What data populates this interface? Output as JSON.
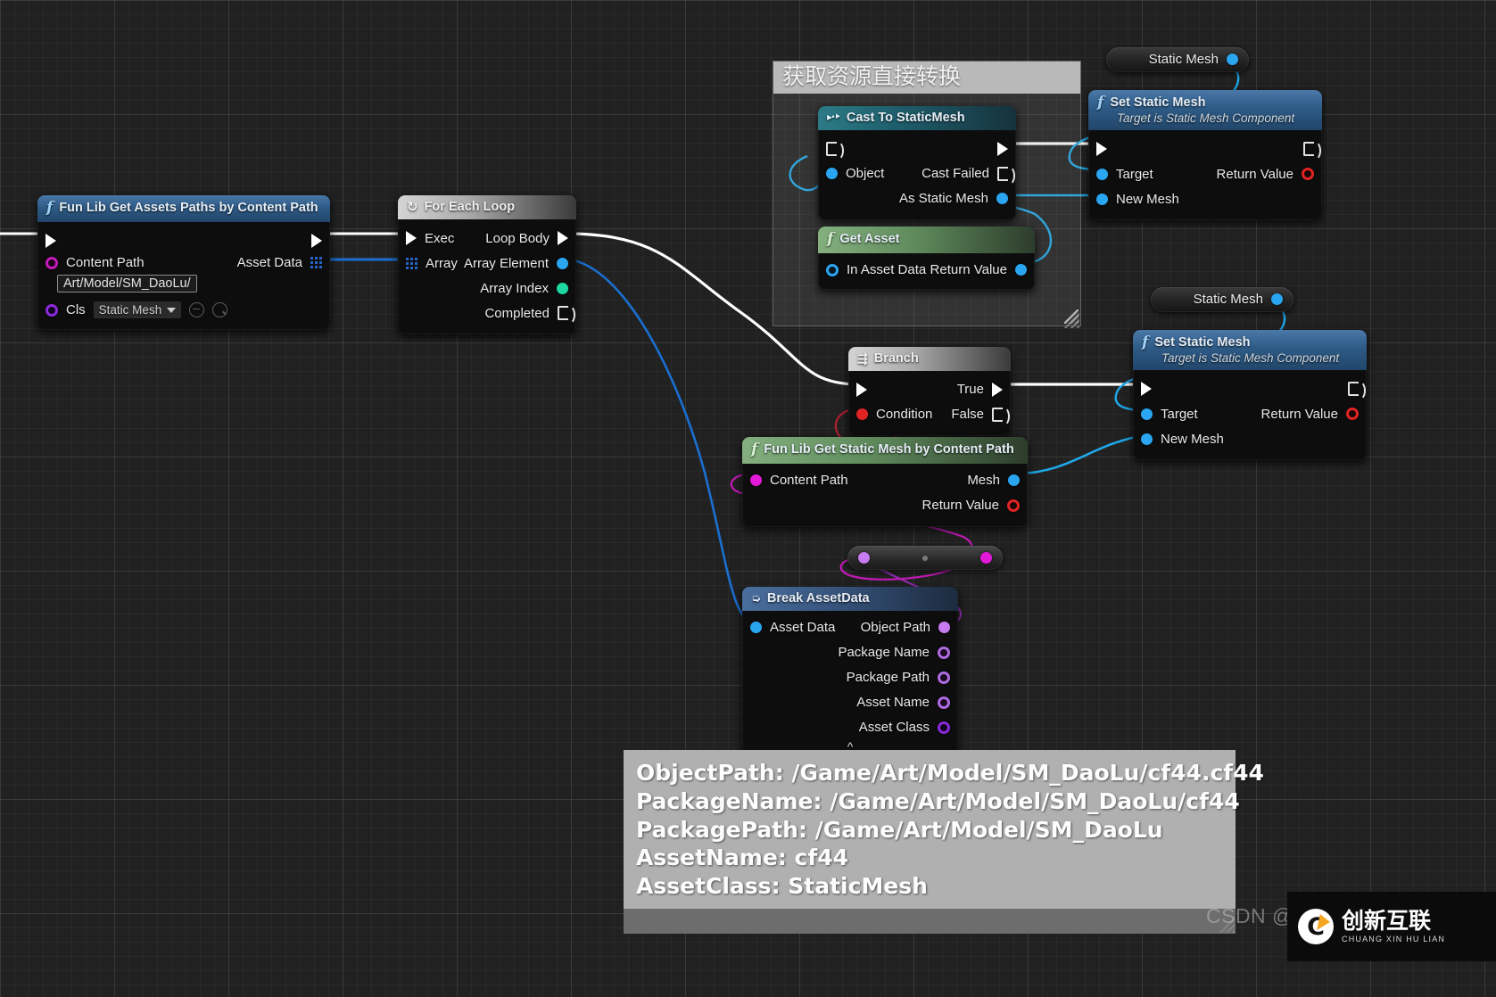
{
  "app": {
    "kind": "unreal-blueprint-graph"
  },
  "comment": {
    "title": "获取资源直接转换"
  },
  "nodes": {
    "fun_lib_get_assets_paths": {
      "title": "Fun Lib Get Assets Paths by Content Path",
      "icon": "function-f-icon",
      "inputs": {
        "exec": "",
        "content_path_label": "Content Path",
        "content_path_value": "Art/Model/SM_DaoLu/",
        "cls_label": "Cls",
        "cls_value": "Static Mesh"
      },
      "outputs": {
        "exec": "",
        "asset_data": "Asset Data"
      }
    },
    "for_each_loop": {
      "title": "For Each Loop",
      "icon": "loop-icon",
      "inputs": {
        "exec": "Exec",
        "array": "Array"
      },
      "outputs": {
        "loop_body": "Loop Body",
        "array_element": "Array Element",
        "array_index": "Array Index",
        "completed": "Completed"
      }
    },
    "cast_to_static_mesh": {
      "title": "Cast To StaticMesh",
      "icon": "cast-icon",
      "inputs": {
        "exec": "",
        "object": "Object"
      },
      "outputs": {
        "exec": "",
        "cast_failed": "Cast Failed",
        "as_static_mesh": "As Static Mesh"
      }
    },
    "get_asset": {
      "title": "Get Asset",
      "icon": "function-f-icon",
      "inputs": {
        "in_asset_data": "In Asset Data"
      },
      "outputs": {
        "return_value": "Return Value"
      }
    },
    "set_static_mesh_top": {
      "title": "Set Static Mesh",
      "subtitle": "Target is Static Mesh Component",
      "icon": "function-f-icon",
      "inputs": {
        "exec": "",
        "target": "Target",
        "new_mesh": "New Mesh"
      },
      "outputs": {
        "exec": "",
        "return_value": "Return Value"
      }
    },
    "set_static_mesh_bottom": {
      "title": "Set Static Mesh",
      "subtitle": "Target is Static Mesh Component",
      "icon": "function-f-icon",
      "inputs": {
        "exec": "",
        "target": "Target",
        "new_mesh": "New Mesh"
      },
      "outputs": {
        "exec": "",
        "return_value": "Return Value"
      }
    },
    "branch": {
      "title": "Branch",
      "icon": "branch-icon",
      "inputs": {
        "exec": "",
        "condition": "Condition"
      },
      "outputs": {
        "true": "True",
        "false": "False"
      }
    },
    "fun_lib_get_static_mesh": {
      "title": "Fun Lib Get Static Mesh by Content Path",
      "icon": "function-f-icon",
      "inputs": {
        "content_path": "Content Path"
      },
      "outputs": {
        "mesh": "Mesh",
        "return_value": "Return Value"
      }
    },
    "break_asset_data": {
      "title": "Break AssetData",
      "icon": "break-struct-icon",
      "inputs": {
        "asset_data": "Asset Data"
      },
      "outputs": {
        "object_path": "Object Path",
        "package_name": "Package Name",
        "package_path": "Package Path",
        "asset_name": "Asset Name",
        "asset_class": "Asset Class"
      }
    },
    "var_static_mesh_top": {
      "title": "Static Mesh"
    },
    "var_static_mesh_bottom": {
      "title": "Static Mesh"
    }
  },
  "tooltip": {
    "lines": [
      "ObjectPath: /Game/Art/Model/SM_DaoLu/cf44.cf44",
      "PackageName: /Game/Art/Model/SM_DaoLu/cf44",
      "PackagePath: /Game/Art/Model/SM_DaoLu",
      "AssetName: cf44",
      "AssetClass: StaticMesh"
    ]
  },
  "watermarks": {
    "csdn": "CSDN @t",
    "brand_cn": "创新互联",
    "brand_en": "CHUANG XIN HU LIAN",
    "brand_mark": "C"
  },
  "colors": {
    "exec_white": "#ffffff",
    "object_blue": "#2aa5f0",
    "bool_red": "#e02424",
    "string_magenta": "#e21ad8",
    "class_purple": "#7b1fc4",
    "name_lilac": "#c77bf0",
    "struct_array_blue": "#2563c9",
    "comment_header": "#b9b9b9",
    "tooltip_bg": "#b0b0b0"
  }
}
